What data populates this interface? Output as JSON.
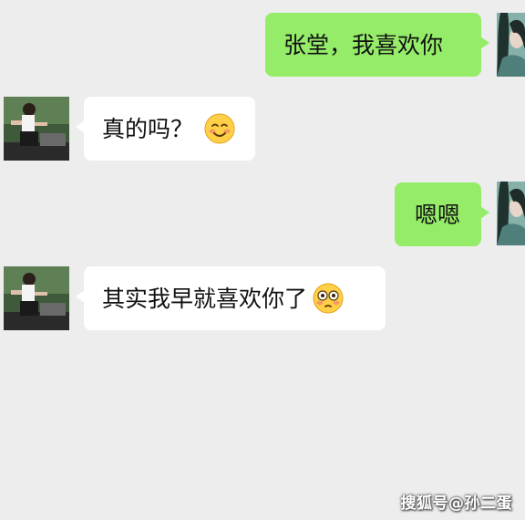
{
  "messages": [
    {
      "side": "out",
      "text": "张堂，我喜欢你",
      "emoji": null
    },
    {
      "side": "in",
      "text": "真的吗？",
      "emoji": "smiling-blush-emoji"
    },
    {
      "side": "out",
      "text": "嗯嗯",
      "emoji": null
    },
    {
      "side": "in",
      "text": "其实我早就喜欢你了",
      "emoji": "flushed-emoji"
    }
  ],
  "watermark": "搜狐号@孙二蛋",
  "colors": {
    "background": "#ededed",
    "outgoing_bubble": "#95ec69",
    "incoming_bubble": "#ffffff"
  }
}
